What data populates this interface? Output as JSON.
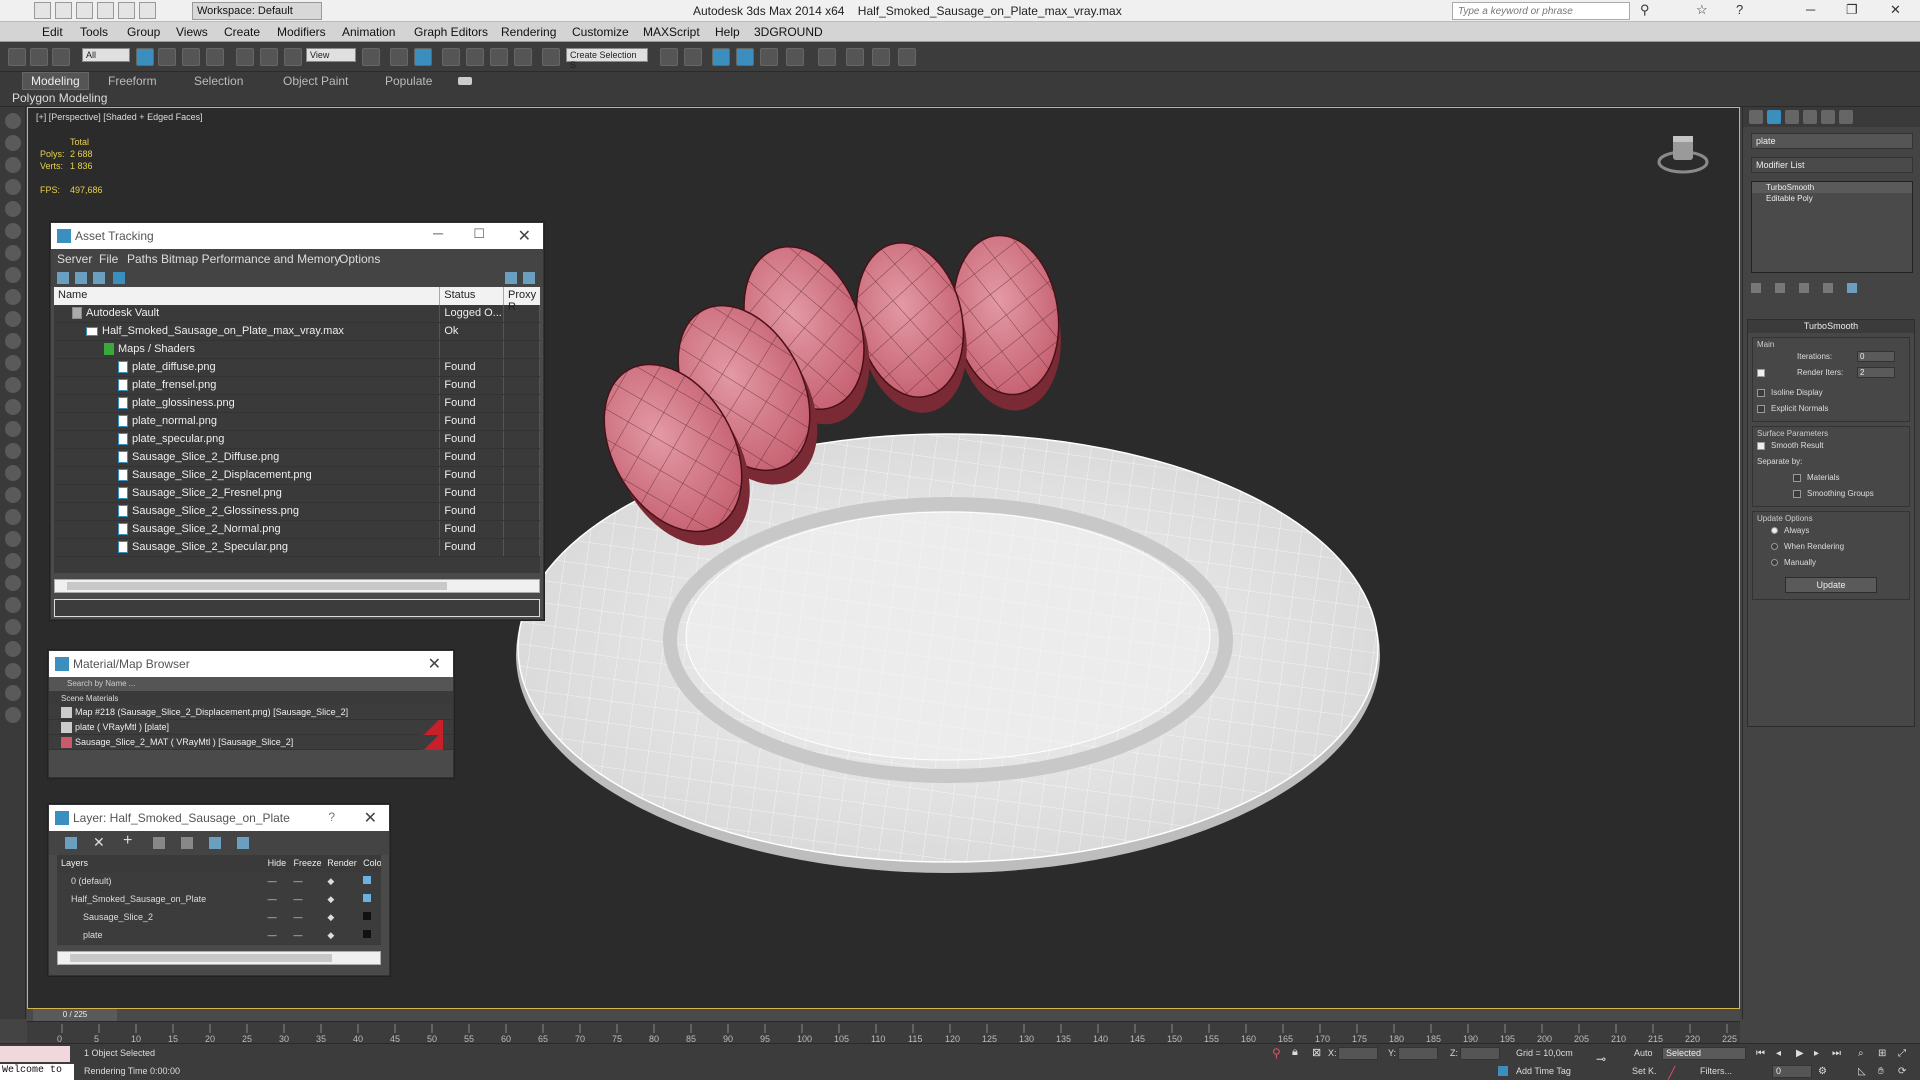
{
  "window": {
    "app_title": "Autodesk 3ds Max  2014 x64",
    "file_title": "Half_Smoked_Sausage_on_Plate_max_vray.max",
    "workspace": "Workspace: Default",
    "search_placeholder": "Type a keyword or phrase"
  },
  "menu": [
    "Edit",
    "Tools",
    "Group",
    "Views",
    "Create",
    "Modifiers",
    "Animation",
    "Graph Editors",
    "Rendering",
    "Customize",
    "MAXScript",
    "Help",
    "3DGROUND"
  ],
  "toolbar": {
    "filter": "All",
    "refcoord": "View",
    "selection_set": "Create Selection S"
  },
  "ribbon": {
    "tabs": [
      "Modeling",
      "Freeform",
      "Selection",
      "Object Paint",
      "Populate"
    ],
    "sub": "Polygon Modeling"
  },
  "viewport": {
    "label": "[+] [Perspective] [Shaded + Edged Faces]",
    "stats_header": "Total",
    "polys_label": "Polys:",
    "polys": "2 688",
    "verts_label": "Verts:",
    "verts": "1 836",
    "fps_label": "FPS:",
    "fps": "497,686"
  },
  "asset_tracking": {
    "title": "Asset Tracking",
    "menu": [
      "Server",
      "File",
      "Paths",
      "Bitmap Performance and Memory",
      "Options"
    ],
    "columns": [
      "Name",
      "Status",
      "Proxy R"
    ],
    "rows": [
      {
        "name": "Autodesk Vault",
        "status": "Logged O..."
      },
      {
        "name": "Half_Smoked_Sausage_on_Plate_max_vray.max",
        "status": "Ok"
      },
      {
        "name": "Maps / Shaders",
        "status": ""
      },
      {
        "name": "plate_diffuse.png",
        "status": "Found"
      },
      {
        "name": "plate_frensel.png",
        "status": "Found"
      },
      {
        "name": "plate_glossiness.png",
        "status": "Found"
      },
      {
        "name": "plate_normal.png",
        "status": "Found"
      },
      {
        "name": "plate_specular.png",
        "status": "Found"
      },
      {
        "name": "Sausage_Slice_2_Diffuse.png",
        "status": "Found"
      },
      {
        "name": "Sausage_Slice_2_Displacement.png",
        "status": "Found"
      },
      {
        "name": "Sausage_Slice_2_Fresnel.png",
        "status": "Found"
      },
      {
        "name": "Sausage_Slice_2_Glossiness.png",
        "status": "Found"
      },
      {
        "name": "Sausage_Slice_2_Normal.png",
        "status": "Found"
      },
      {
        "name": "Sausage_Slice_2_Specular.png",
        "status": "Found"
      }
    ]
  },
  "material_browser": {
    "title": "Material/Map Browser",
    "search": "Search by Name ...",
    "group": "Scene Materials",
    "items": [
      "Map #218 (Sausage_Slice_2_Displacement.png)  [Sausage_Slice_2]",
      "plate  ( VRayMtl )  [plate]",
      "Sausage_Slice_2_MAT  ( VRayMtl )  [Sausage_Slice_2]"
    ]
  },
  "layer_manager": {
    "title": "Layer: Half_Smoked_Sausage_on_Plate",
    "columns": [
      "Layers",
      "Hide",
      "Freeze",
      "Render",
      "Color"
    ],
    "rows": [
      "0 (default)",
      "Half_Smoked_Sausage_on_Plate",
      "Sausage_Slice_2",
      "plate"
    ]
  },
  "command_panel": {
    "object_name": "plate",
    "modifier_list": "Modifier List",
    "stack": [
      "TurboSmooth",
      "Editable Poly"
    ],
    "turbosmooth": {
      "title": "TurboSmooth",
      "main": "Main",
      "iterations_label": "Iterations:",
      "iterations": "0",
      "render_iters_label": "Render Iters:",
      "render_iters": "2",
      "isoline": "Isoline Display",
      "explicit_normals": "Explicit Normals",
      "surface_params": "Surface Parameters",
      "smooth_result": "Smooth Result",
      "separate_by": "Separate by:",
      "materials": "Materials",
      "smoothing_groups": "Smoothing Groups",
      "update_options": "Update Options",
      "always": "Always",
      "when_rendering": "When Rendering",
      "manually": "Manually",
      "update_btn": "Update"
    }
  },
  "timeline": {
    "frame": "0 / 225",
    "ticks": [
      "0",
      "5",
      "10",
      "15",
      "20",
      "25",
      "30",
      "35",
      "40",
      "45",
      "50",
      "55",
      "60",
      "65",
      "70",
      "75",
      "80",
      "85",
      "90",
      "95",
      "100",
      "105",
      "110",
      "115",
      "120",
      "125",
      "130",
      "135",
      "140",
      "145",
      "150",
      "155",
      "160",
      "165",
      "170",
      "175",
      "180",
      "185",
      "190",
      "195",
      "200",
      "205",
      "210",
      "215",
      "220",
      "225"
    ]
  },
  "status": {
    "welcome": "Welcome to",
    "selected": "1 Object Selected",
    "render_time": "Rendering Time  0:00:00",
    "x_label": "X:",
    "y_label": "Y:",
    "z_label": "Z:",
    "grid": "Grid = 10,0cm",
    "add_time_tag": "Add Time Tag",
    "auto": "Auto",
    "set_k": "Set K.",
    "selected_combo": "Selected",
    "filters": "Filters...",
    "frame_field": "0"
  },
  "colors": {
    "accent": "#3a8fbf",
    "viewport_border": "#d4b64a",
    "sausage": "#c95a6a",
    "plate": "#e6e6e6"
  }
}
